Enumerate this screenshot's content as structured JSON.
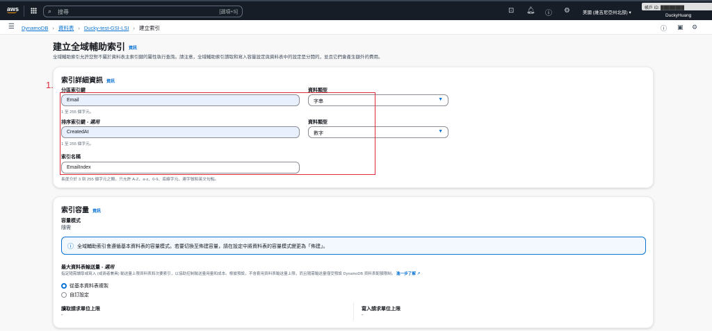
{
  "topbar": {
    "logo": "aws",
    "search_placeholder": "搜尋",
    "search_shortcut": "[選項+S]",
    "region": "美國 (維吉尼亞州北部)",
    "account": "帳戶 ID: ████████",
    "user": "DuckyHuang"
  },
  "breadcrumb": [
    "DynamoDB",
    "資料表",
    "Ducky-test-GSI-LSI",
    "建立索引"
  ],
  "page": {
    "title": "建立全域輔助索引",
    "info": "資訊",
    "description": "全域輔助索引允許您對不屬於資料表主索引鍵的屬性執行查詢。請注意，全域輔助索引讀取和寫入容量設定與資料表中的設定是分開的，並且它們會產生額外的費用。"
  },
  "annotation": "1.",
  "details": {
    "title": "索引詳細資訊",
    "info": "資訊",
    "partition_label": "分區索引鍵",
    "partition_value": "Email",
    "partition_hint": "1 至 255 個字元。",
    "partition_type_label": "資料類型",
    "partition_type": "字串",
    "sort_label": "排序索引鍵 - ",
    "sort_optional": "選用",
    "sort_value": "CreatedAt",
    "sort_hint": "1 至 255 個字元。",
    "sort_type_label": "資料類型",
    "sort_type": "數字",
    "name_label": "索引名稱",
    "name_value": "EmailIndex",
    "name_hint": "長度介於 3 到 255 個字元之間，只允許 A-Z、a-z、0-9、底線字元、連字號和英文句點。"
  },
  "capacity": {
    "title": "索引容量",
    "info": "資訊",
    "mode_label": "容量模式",
    "mode_value": "隨需",
    "alert": "全域輔助索引會遵循基本資料表的容量模式。若要切換至佈建容量，請在設定中將資料表的容量模式變更為「佈建」。",
    "throughput_label": "最大資料表輸送量 - ",
    "throughput_optional": "選用",
    "throughput_desc": "指定隨需讀取或寫入 (或兩者兼具) 輸送量上限資料表和次要索引，以協助控制輸送量用量和成本。根據預設，不會套用資料表輸送量上限，而且隨需輸送量僅受預設 DynamoDB 資料表配額限制。",
    "learn_more": "進一步了解",
    "options": [
      "從基本資料表複製",
      "自訂設定"
    ],
    "read_label": "讀取請求單位上限",
    "read_value": "-",
    "write_label": "寫入請求單位上限",
    "write_value": "-"
  }
}
